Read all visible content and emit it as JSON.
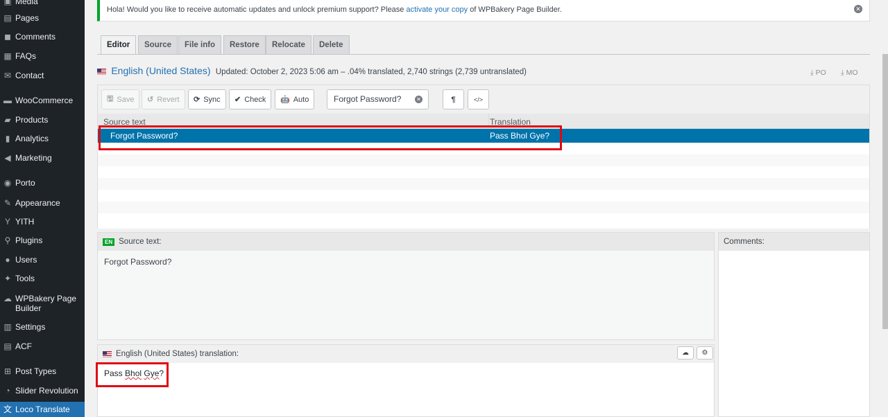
{
  "sidebar": {
    "items": [
      {
        "label": "Media",
        "icon": "media-icon"
      },
      {
        "label": "Pages",
        "icon": "pages-icon"
      },
      {
        "label": "Comments",
        "icon": "comments-icon"
      },
      {
        "label": "FAQs",
        "icon": "faqs-icon"
      },
      {
        "label": "Contact",
        "icon": "contact-icon"
      },
      {
        "label": "WooCommerce",
        "icon": "woocommerce-icon"
      },
      {
        "label": "Products",
        "icon": "products-icon"
      },
      {
        "label": "Analytics",
        "icon": "analytics-icon"
      },
      {
        "label": "Marketing",
        "icon": "marketing-icon"
      },
      {
        "label": "Porto",
        "icon": "porto-icon"
      },
      {
        "label": "Appearance",
        "icon": "appearance-icon"
      },
      {
        "label": "YITH",
        "icon": "yith-icon"
      },
      {
        "label": "Plugins",
        "icon": "plugins-icon"
      },
      {
        "label": "Users",
        "icon": "users-icon"
      },
      {
        "label": "Tools",
        "icon": "tools-icon"
      },
      {
        "label": "WPBakery Page",
        "label2": "Builder",
        "icon": "wpbakery-icon"
      },
      {
        "label": "Settings",
        "icon": "settings-icon"
      },
      {
        "label": "ACF",
        "icon": "acf-icon"
      },
      {
        "label": "Post Types",
        "icon": "post-types-icon"
      },
      {
        "label": "Slider Revolution",
        "icon": "slider-revolution-icon"
      },
      {
        "label": "Loco Translate",
        "icon": "loco-translate-icon",
        "active": true
      }
    ]
  },
  "notice": {
    "text_before": "Hola! Would you like to receive automatic updates and unlock premium support? Please",
    "link": "activate your copy",
    "text_after": "of WPBakery Page Builder."
  },
  "tabs": [
    "Editor",
    "Source",
    "File info",
    "Restore",
    "Relocate",
    "Delete"
  ],
  "locale": {
    "name": "English (United States)",
    "meta": "Updated: October 2, 2023 5:06 am – .04% translated, 2,740 strings (2,739 untranslated)",
    "download_po": "PO",
    "download_mo": "MO"
  },
  "toolbar": {
    "save": "Save",
    "revert": "Revert",
    "sync": "Sync",
    "check": "Check",
    "auto": "Auto",
    "search_value": "Forgot Password?",
    "pilcrow": "¶",
    "code": "</>"
  },
  "grid": {
    "headers": [
      "Source text",
      "Translation"
    ],
    "rows": [
      {
        "source": "Forgot Password?",
        "translation": "Pass Bhol Gye?"
      }
    ]
  },
  "source_panel": {
    "badge": "EN",
    "title": "Source text:",
    "text": "Forgot Password?"
  },
  "comments_panel": {
    "title": "Comments:"
  },
  "translation_panel": {
    "title": "English (United States) translation:",
    "word1": "Pass",
    "word2": "Bhol",
    "word3": "Gye",
    "suffix": "?"
  },
  "colors": {
    "sidebar_bg": "#1d2327",
    "active_blue": "#2271b1",
    "selected_row": "#0073aa",
    "highlight_red": "#e00912",
    "notice_green": "#00a32a"
  }
}
